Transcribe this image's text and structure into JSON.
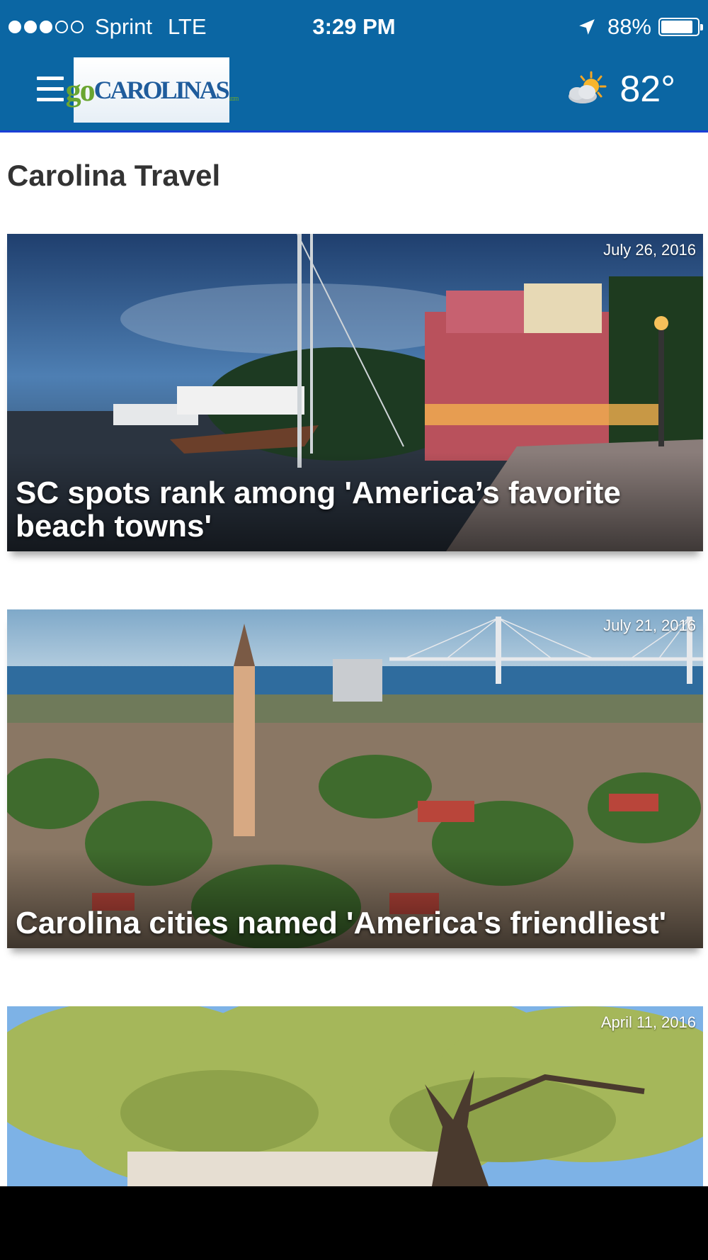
{
  "status_bar": {
    "signal_dots_filled": 3,
    "signal_dots_total": 5,
    "carrier": "Sprint",
    "network": "LTE",
    "time": "3:29 PM",
    "battery": "88%",
    "battery_level": 0.88,
    "location_icon": "location-arrow-icon"
  },
  "header": {
    "menu_icon": "hamburger-menu-icon",
    "logo": {
      "go": "go",
      "name": "CAROLINAS",
      "suffix": ".com"
    },
    "weather": {
      "icon": "partly-cloudy-sun-icon",
      "temperature": "82°"
    }
  },
  "page": {
    "section_title": "Carolina Travel"
  },
  "articles": [
    {
      "date": "July 26, 2016",
      "title": "SC spots rank among 'America’s favorite beach towns'"
    },
    {
      "date": "July 21, 2016",
      "title": "Carolina cities named 'America's friendliest'"
    },
    {
      "date": "April 11, 2016",
      "title": ""
    }
  ],
  "colors": {
    "header_bg": "#0b66a3",
    "header_border": "#1a3fd6",
    "title_text": "#333333"
  }
}
